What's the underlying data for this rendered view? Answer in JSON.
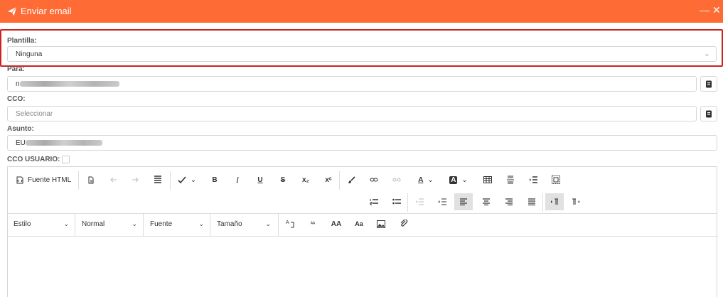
{
  "window": {
    "title": "Enviar email",
    "send_icon": "paper-plane-icon",
    "minimize_glyph": "—",
    "close_glyph": "✕"
  },
  "form": {
    "plantilla": {
      "label": "Plantilla:",
      "value": "Ninguna"
    },
    "para": {
      "label": "Para:",
      "value": "n"
    },
    "cco": {
      "label": "CCO:",
      "placeholder": "Seleccionar"
    },
    "asunto": {
      "label": "Asunto:",
      "value": "EU"
    },
    "cco_usuario": {
      "label": "CCO USUARIO:",
      "checked": false
    }
  },
  "editor": {
    "source_button": "Fuente HTML",
    "style_dropdown": "Estilo",
    "format_dropdown": "Normal",
    "font_dropdown": "Fuente",
    "size_dropdown": "Tamaño",
    "bold_glyph": "B",
    "italic_glyph": "I",
    "underline_glyph": "U",
    "strike_glyph": "S",
    "subscript_glyph": "x₂",
    "superscript_glyph": "xᶜ",
    "font_color_glyph": "A",
    "bg_color_glyph": "A",
    "uppercase_glyph": "AA",
    "lowercase_glyph": "Aa",
    "small_glyph": "ᴬᴬ",
    "chevron_glyph": "⌄"
  },
  "colors": {
    "accent": "#ff6b35",
    "highlight_border": "#cc2222"
  }
}
